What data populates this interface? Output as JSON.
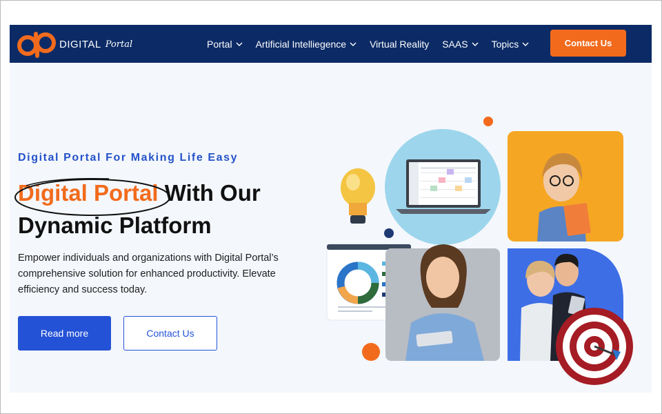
{
  "brand": {
    "name": "DIGITAL",
    "script": "Portal"
  },
  "nav": {
    "items": [
      {
        "label": "Portal",
        "has_dropdown": true
      },
      {
        "label": "Artificial Intelliegence",
        "has_dropdown": true
      },
      {
        "label": "Virtual Reality",
        "has_dropdown": false
      },
      {
        "label": "SAAS",
        "has_dropdown": true
      },
      {
        "label": "Topics",
        "has_dropdown": true
      }
    ],
    "cta_label": "Contact Us"
  },
  "hero": {
    "eyebrow": "Digital Portal For Making Life Easy",
    "headline_accent": "Digital Portal",
    "headline_rest_line1": "With Our",
    "headline_line2": "Dynamic Platform",
    "description": "Empower individuals and organizations with Digital Portal’s comprehensive solution for enhanced productivity. Elevate efficiency and success today.",
    "primary_button": "Read more",
    "secondary_button": "Contact Us"
  },
  "colors": {
    "nav_bg": "#0c2b66",
    "accent_orange": "#f26b1d",
    "primary_blue": "#2452d6",
    "page_bg": "#f4f7fc"
  },
  "icons": [
    "logo-dp-icon",
    "chevron-down-icon",
    "lightbulb-icon",
    "laptop-calendar-icon",
    "donut-chart-icon",
    "target-icon"
  ]
}
